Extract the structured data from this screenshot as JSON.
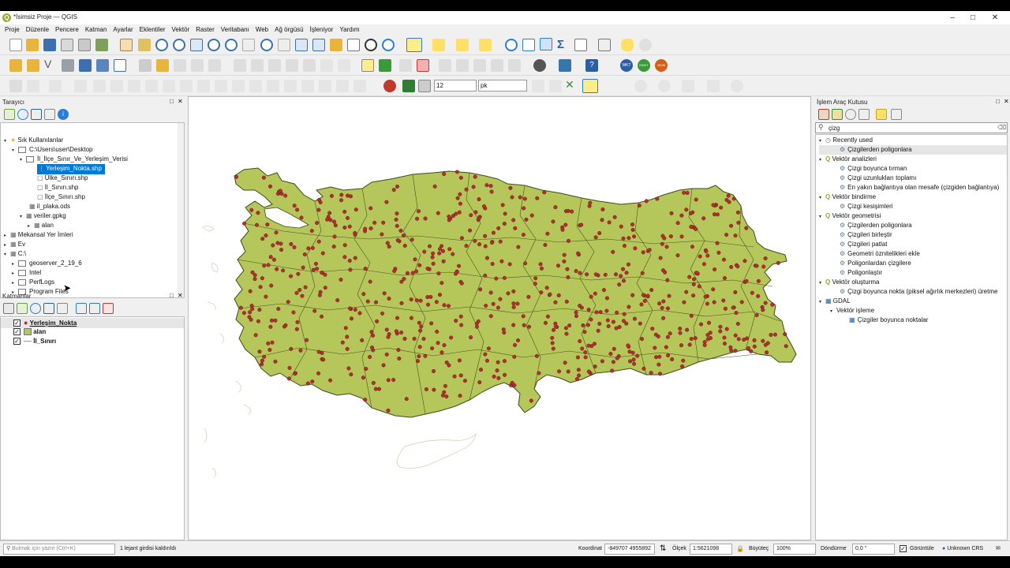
{
  "window": {
    "title": "*İsimsiz Proje — QGIS"
  },
  "menu": [
    "Proje",
    "Düzenle",
    "Pencere",
    "Katman",
    "Ayarlar",
    "Eklentiler",
    "Vektör",
    "Raster",
    "Veritabanı",
    "Web",
    "Ağ örgüsü",
    "İşleniyor",
    "Yardım"
  ],
  "digitizing": {
    "snap_tolerance": "12",
    "snap_unit": "pk"
  },
  "browser": {
    "title": "Tarayıcı",
    "items": [
      {
        "label": "Sık Kullanılanlar"
      },
      {
        "label": "C:\\Users\\user\\Desktop"
      },
      {
        "label": "İl_İlçe_Sınır_Ve_Yerleşim_Verisi"
      },
      {
        "label": "Yerleşim_Nokta.shp"
      },
      {
        "label": "Ülke_Sınırı.shp"
      },
      {
        "label": "İl_Sınırı.shp"
      },
      {
        "label": "İlçe_Sınırı.shp"
      },
      {
        "label": "il_plaka.ods"
      },
      {
        "label": "veriler.gpkg"
      },
      {
        "label": "alan"
      },
      {
        "label": "Mekansal Yer İmleri"
      },
      {
        "label": "Ev"
      },
      {
        "label": "C:\\"
      },
      {
        "label": "geoserver_2_19_6"
      },
      {
        "label": "Intel"
      },
      {
        "label": "PerfLogs"
      },
      {
        "label": "Program Files"
      }
    ]
  },
  "layers": {
    "title": "Katmanlar",
    "items": [
      {
        "label": "Yerleşim_Nokta",
        "color": "#b03030"
      },
      {
        "label": "alan",
        "color": "#b5c65a"
      },
      {
        "label": "İl_Sınırı",
        "color": "#999999"
      }
    ]
  },
  "toolbox": {
    "title": "İşlem Araç Kutusu",
    "search_value": "çizg",
    "items": [
      {
        "label": "Recently used"
      },
      {
        "label": "Çizgilerden poligonlara"
      },
      {
        "label": "Vektör analizleri"
      },
      {
        "label": "Çizgi boyunca tırman"
      },
      {
        "label": "Çizgi uzunlukları toplamı"
      },
      {
        "label": "En yakın bağlantıya olan mesafe (çizgiden bağlantıya)"
      },
      {
        "label": "Vektör bindirme"
      },
      {
        "label": "Çizgi kesişimleri"
      },
      {
        "label": "Vektör geometrisi"
      },
      {
        "label": "Çizgilerden poligonlara"
      },
      {
        "label": "Çizgileri birleştir"
      },
      {
        "label": "Çizgileri patlat"
      },
      {
        "label": "Geometri öznitelikleri ekle"
      },
      {
        "label": "Poligonlardan çizgilere"
      },
      {
        "label": "Poligonlaştır"
      },
      {
        "label": "Vektör oluşturma"
      },
      {
        "label": "Çizgi boyunca nokta (piksel ağırlık merkezleri) üretme"
      },
      {
        "label": "GDAL"
      },
      {
        "label": "Vektör işleme"
      },
      {
        "label": "Çizgiler boyunca noktalar"
      }
    ]
  },
  "status": {
    "search_placeholder": "Bulmak için yazın (Ctrl+K)",
    "message": "1 lejant girdisi kaldırıldı",
    "coord_label": "Koordinat",
    "coord_value": "-849707 4955892",
    "scale_label": "Ölçek",
    "scale_value": "1:5621098",
    "magnifier_label": "Büyüteç",
    "magnifier_value": "100%",
    "rotation_label": "Döndürme",
    "rotation_value": "0,0 °",
    "render_label": "Görüntüle",
    "crs_label": "Unknown CRS"
  },
  "map": {
    "fill_color": "#b5c65a",
    "point_color": "#b03030",
    "boundary_color": "#4a5220"
  }
}
